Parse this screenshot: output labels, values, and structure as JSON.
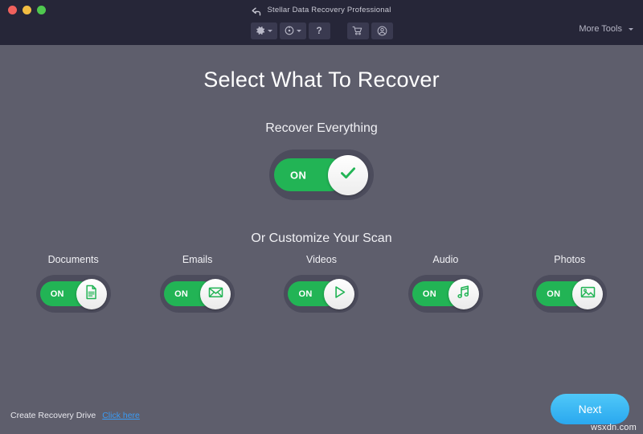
{
  "window": {
    "title": "Stellar Data Recovery Professional",
    "back_icon": "back-arrow-icon",
    "controls": [
      {
        "name": "close",
        "color": "#f0615d"
      },
      {
        "name": "minimize",
        "color": "#f2bd42"
      },
      {
        "name": "maximize",
        "color": "#4fc84f"
      }
    ]
  },
  "toolbar": {
    "groups": [
      {
        "buttons": [
          {
            "icon": "gear-icon",
            "label": "",
            "has_caret": true
          },
          {
            "icon": "history-icon",
            "label": "",
            "has_caret": true
          },
          {
            "icon": "help-icon",
            "label": "?",
            "has_caret": false
          }
        ]
      },
      {
        "buttons": [
          {
            "icon": "cart-icon",
            "label": "",
            "has_caret": false
          },
          {
            "icon": "user-icon",
            "label": "",
            "has_caret": false
          }
        ]
      }
    ],
    "more_tools_label": "More Tools"
  },
  "main": {
    "headline": "Select What To Recover",
    "everything_label": "Recover Everything",
    "customize_label": "Or Customize Your Scan",
    "master_toggle": {
      "state_label": "ON",
      "enabled": true,
      "icon": "check-icon"
    },
    "categories": [
      {
        "label": "Documents",
        "state_label": "ON",
        "enabled": true,
        "icon": "document-icon"
      },
      {
        "label": "Emails",
        "state_label": "ON",
        "enabled": true,
        "icon": "envelope-icon"
      },
      {
        "label": "Videos",
        "state_label": "ON",
        "enabled": true,
        "icon": "play-icon"
      },
      {
        "label": "Audio",
        "state_label": "ON",
        "enabled": true,
        "icon": "music-note-icon"
      },
      {
        "label": "Photos",
        "state_label": "ON",
        "enabled": true,
        "icon": "image-icon"
      }
    ]
  },
  "footer": {
    "recovery_drive_label": "Create Recovery Drive",
    "recovery_drive_link": "Click here",
    "next_label": "Next",
    "watermark": "wsxdn.com"
  },
  "colors": {
    "titlebar_bg": "#262638",
    "body_bg": "#5e5e6c",
    "toggle_track": "#4c4c5c",
    "toggle_on": "#22b455",
    "link": "#3a9bf4",
    "next_button": "#2aa8ef"
  }
}
